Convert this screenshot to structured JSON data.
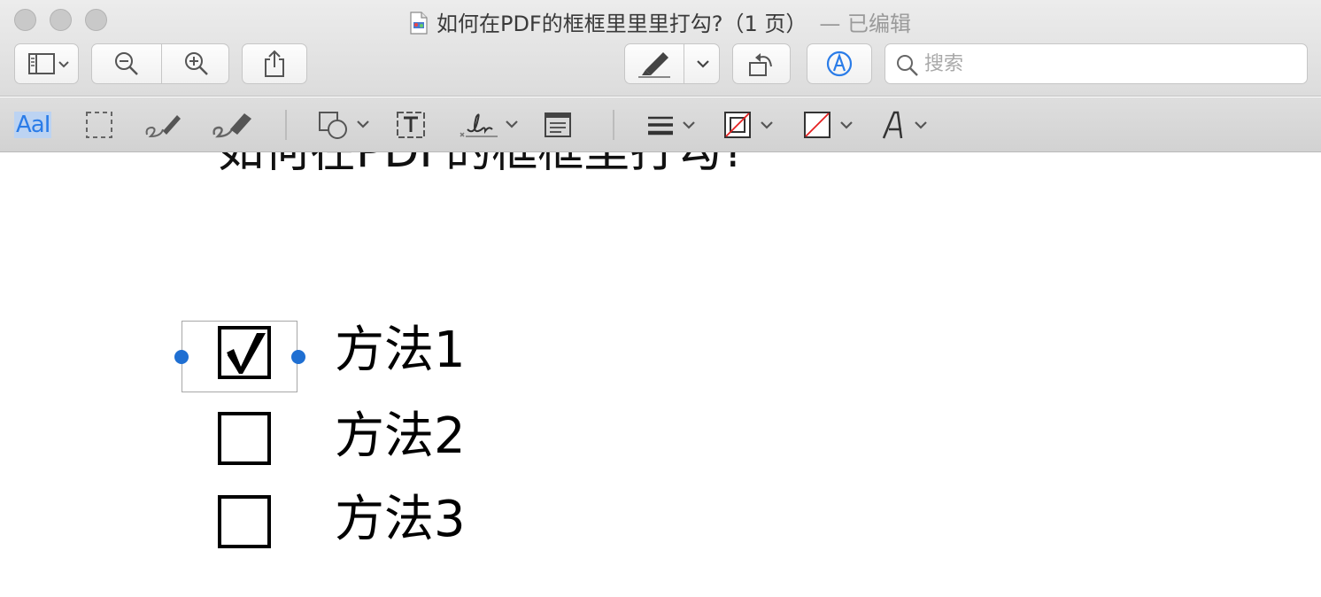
{
  "window": {
    "title": "如何在PDF的框框里里里打勾?（1 页）",
    "edited_label": "— 已编辑"
  },
  "toolbar": {
    "sidebar_icon": "sidebar-icon",
    "zoom_out_icon": "zoom-out-icon",
    "zoom_in_icon": "zoom-in-icon",
    "share_icon": "share-icon",
    "highlight_icon": "highlighter-icon",
    "rotate_icon": "rotate-icon",
    "markup_icon": "markup-icon",
    "search_placeholder": "搜索",
    "accent_color": "#2a7ce8"
  },
  "markup_toolbar": {
    "text_selection_label": "AaI",
    "tools": [
      "text-selection",
      "rectangular-selection",
      "sketch",
      "draw",
      "shapes",
      "text",
      "sign",
      "note",
      "shape-style",
      "border-color",
      "fill-color",
      "text-style"
    ]
  },
  "document": {
    "heading": "如何在PDF的框框里打勾?",
    "options": [
      {
        "label": "方法1",
        "checked": true
      },
      {
        "label": "方法2",
        "checked": false
      },
      {
        "label": "方法3",
        "checked": false
      }
    ],
    "selection_color": "#1f6fd2"
  }
}
